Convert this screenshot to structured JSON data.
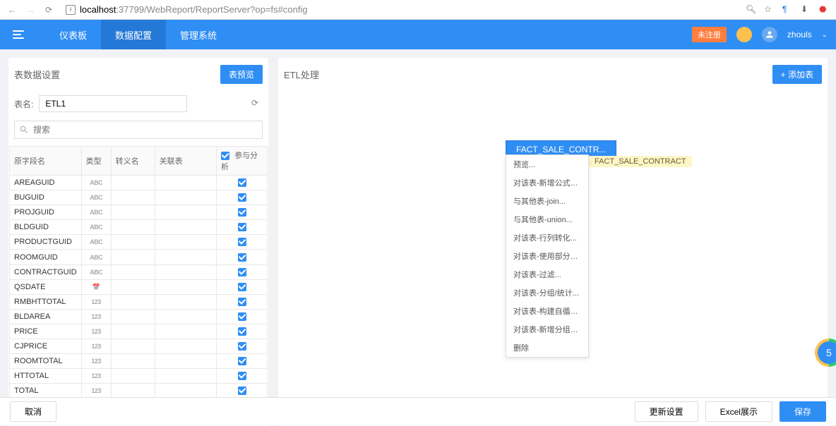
{
  "browser": {
    "url_host": "localhost",
    "url_path": ":37799/WebReport/ReportServer?op=fs#config"
  },
  "header": {
    "nav": [
      "仪表板",
      "数据配置",
      "管理系统"
    ],
    "active_index": 1,
    "register": "未注册",
    "username": "zhouls"
  },
  "left": {
    "title": "表数据设置",
    "preview_btn": "表预览",
    "table_name_label": "表名:",
    "table_name_value": "ETL1",
    "search_placeholder": "搜索",
    "columns": {
      "field": "原字段名",
      "type": "类型",
      "alias": "转义名",
      "related": "关联表",
      "analysis": "参与分析"
    },
    "rows": [
      {
        "name": "AREAGUID",
        "type": "ABC"
      },
      {
        "name": "BUGUID",
        "type": "ABC"
      },
      {
        "name": "PROJGUID",
        "type": "ABC"
      },
      {
        "name": "BLDGUID",
        "type": "ABC"
      },
      {
        "name": "PRODUCTGUID",
        "type": "ABC"
      },
      {
        "name": "ROOMGUID",
        "type": "ABC"
      },
      {
        "name": "CONTRACTGUID",
        "type": "ABC"
      },
      {
        "name": "QSDATE",
        "type": "📅"
      },
      {
        "name": "RMBHTTOTAL",
        "type": "123"
      },
      {
        "name": "BLDAREA",
        "type": "123"
      },
      {
        "name": "PRICE",
        "type": "123"
      },
      {
        "name": "CJPRICE",
        "type": "123"
      },
      {
        "name": "ROOMTOTAL",
        "type": "123"
      },
      {
        "name": "HTTOTAL",
        "type": "123"
      },
      {
        "name": "TOTAL",
        "type": "123"
      }
    ]
  },
  "right": {
    "title": "ETL处理",
    "add_btn": "+ 添加表",
    "node_label": "FACT_SALE_CONTR...",
    "full_label": "FACT_SALE_CONTRACT",
    "menu": [
      "预览...",
      "对该表-新增公式列...",
      "与其他表-join...",
      "与其他表-union...",
      "对该表-行列转化...",
      "对该表-使用部分字段...",
      "对该表-过滤...",
      "对该表-分组/统计...",
      "对该表-构建自循环列...",
      "对该表-新增分组列...",
      "删除"
    ]
  },
  "footer": {
    "cancel": "取消",
    "update": "更新设置",
    "excel": "Excel展示",
    "save": "保存"
  },
  "float_badge": "5"
}
